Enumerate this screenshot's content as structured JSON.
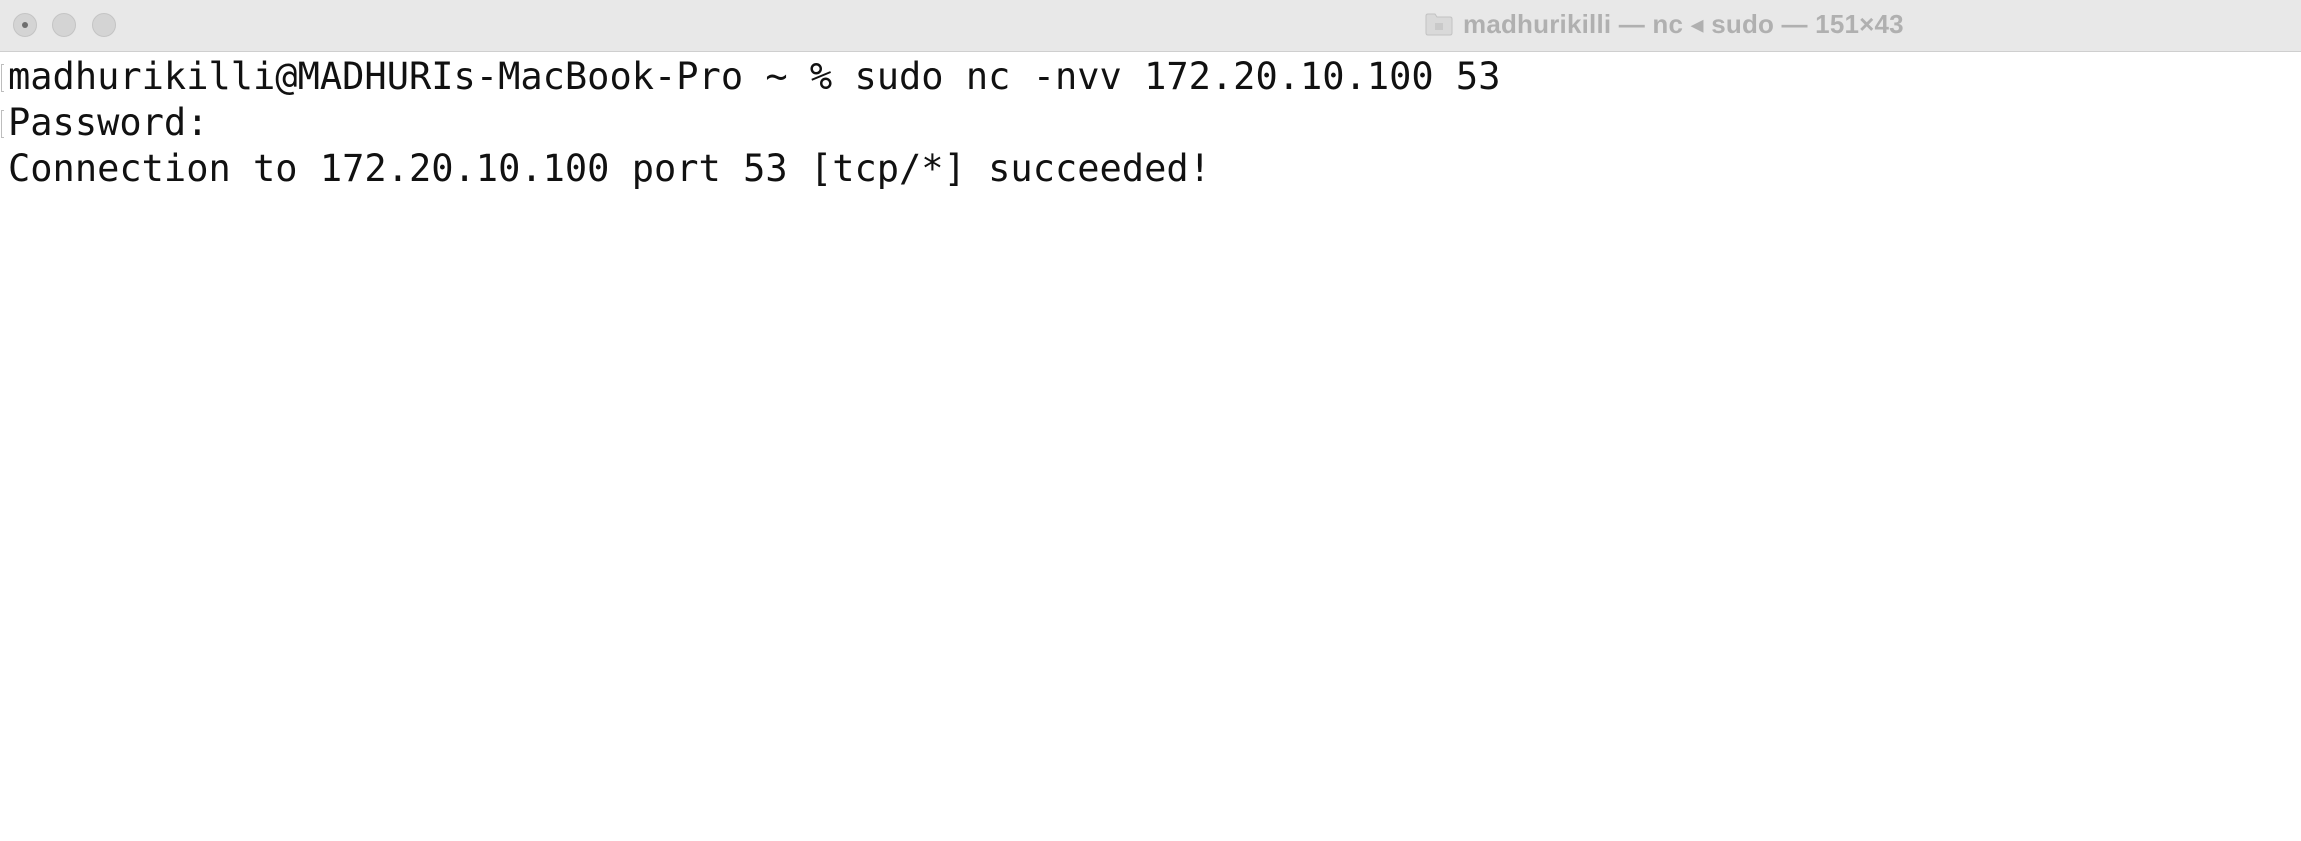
{
  "window": {
    "title": "madhurikilli — nc ◂ sudo — 151×43",
    "controls": {
      "close": "close-button",
      "minimize": "minimize-button",
      "zoom": "zoom-button"
    },
    "title_icon": "folder-icon"
  },
  "terminal": {
    "lines": [
      "madhurikilli@MADHURIs-MacBook-Pro ~ % sudo nc -nvv 172.20.10.100 53",
      "Password:",
      "Connection to 172.20.10.100 port 53 [tcp/*] succeeded!"
    ]
  },
  "colors": {
    "titlebar": "#e8e8e8",
    "title_text": "#b0b0b0",
    "terminal_bg": "#ffffff",
    "terminal_text": "#111111"
  }
}
